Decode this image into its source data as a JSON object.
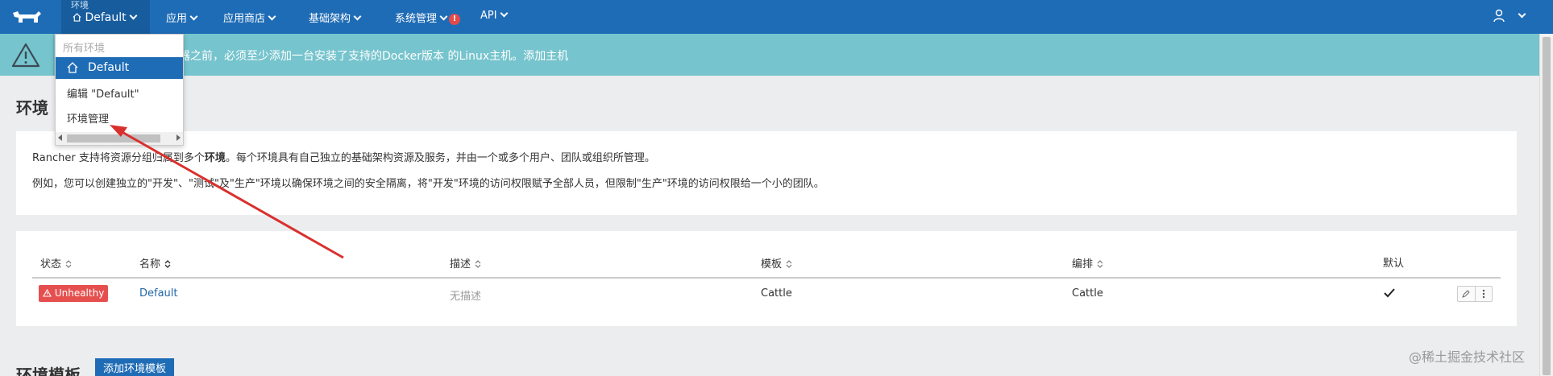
{
  "topnav": {
    "env_caption": "环境",
    "env_value": "Default",
    "items": [
      {
        "label": "应用"
      },
      {
        "label": "应用商店"
      },
      {
        "label": "基础架构"
      },
      {
        "label": "系统管理"
      },
      {
        "label": "API"
      }
    ],
    "alert_mark": "!"
  },
  "banner": {
    "text_before": "器之前，必须至少添加一台安装了",
    "link1": "支持的Docker版本",
    "text_mid": "的Linux主机。",
    "link2": "添加主机"
  },
  "dropdown": {
    "header": "所有环境",
    "active_item": "Default",
    "items": [
      "编辑 \"Default\"",
      "环境管理"
    ]
  },
  "page": {
    "title": "环境",
    "desc_line1_pre": "Rancher 支持将资源分组归属到多个",
    "desc_line1_bold": "环境",
    "desc_line1_post": "。每个环境具有自己独立的基础架构资源及服务，并由一个或多个用户、团队或组织所管理。",
    "desc_line2": "例如，您可以创建独立的\"开发\"、\"测试\"及\"生产\"环境以确保环境之间的安全隔离，将\"开发\"环境的访问权限赋予全部人员，但限制\"生产\"环境的访问权限给一个小的团队。"
  },
  "table": {
    "headers": [
      "状态",
      "名称",
      "描述",
      "模板",
      "编排",
      "默认"
    ],
    "rows": [
      {
        "status": "Unhealthy",
        "name": "Default",
        "description": "无描述",
        "template": "Cattle",
        "orchestration": "Cattle"
      }
    ]
  },
  "templates_section": {
    "title": "环境模板",
    "add_button": "添加环境模板"
  },
  "watermark": "@稀土掘金技术社区",
  "colors": {
    "nav": "#1f6cb6",
    "banner": "#76c4cd",
    "unhealthy": "#e5504f",
    "annotation_arrow": "#d9302e"
  }
}
